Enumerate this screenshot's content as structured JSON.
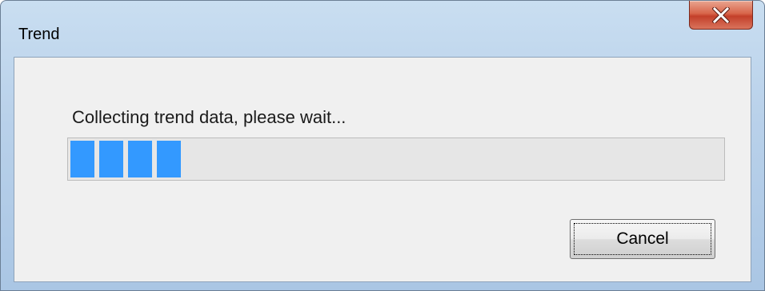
{
  "window": {
    "title": "Trend"
  },
  "titlebar": {
    "close_icon": "close-icon"
  },
  "dialog": {
    "message": "Collecting trend data, please wait...",
    "progress": {
      "filled_blocks": 4,
      "color": "#3399ff"
    },
    "cancel_label": "Cancel"
  }
}
